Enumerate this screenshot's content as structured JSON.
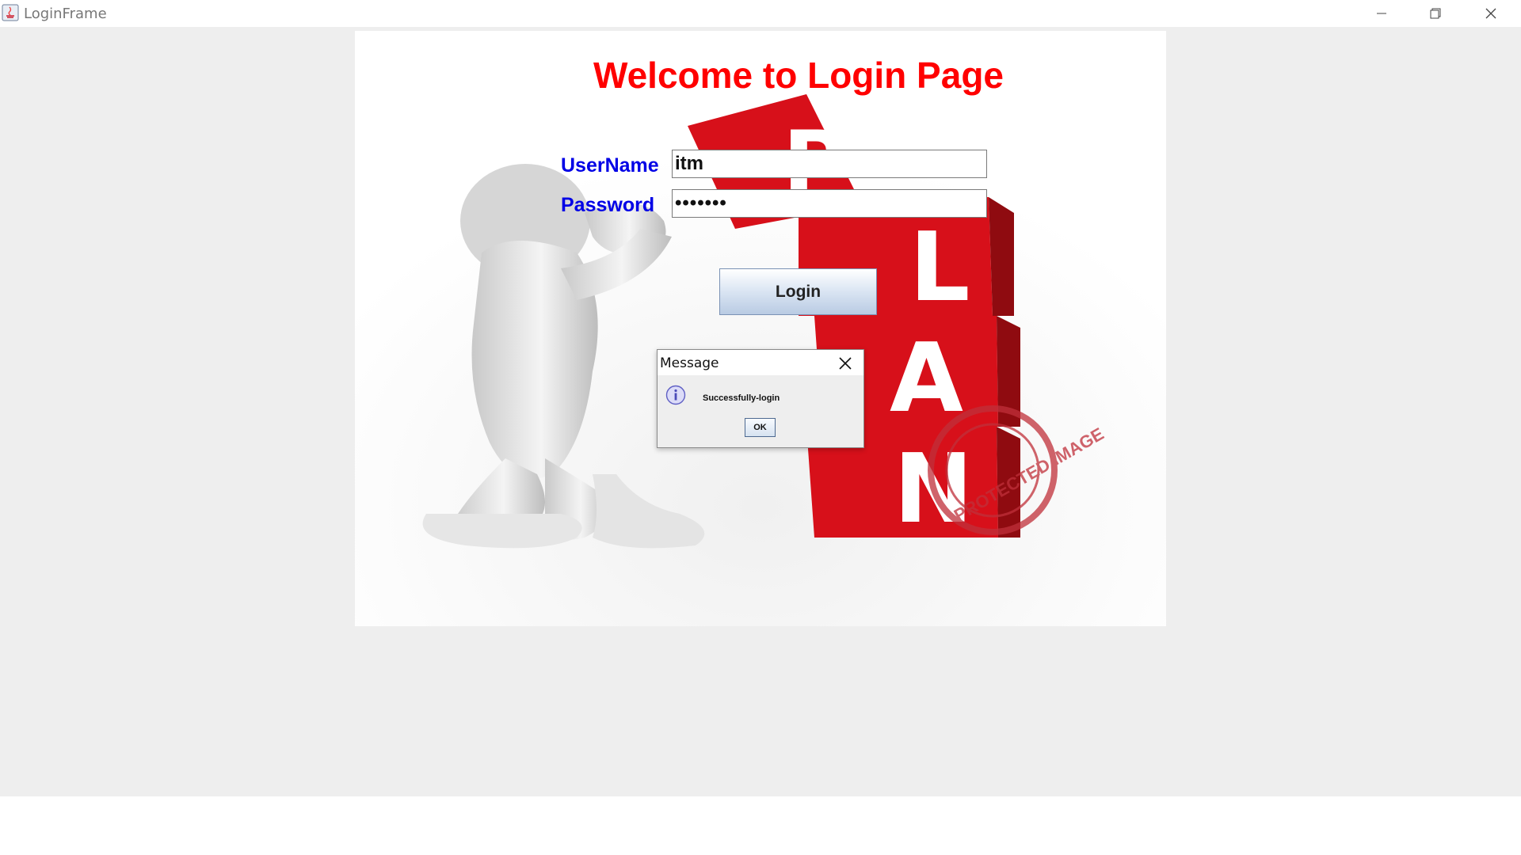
{
  "window": {
    "title": "LoginFrame"
  },
  "page": {
    "heading": "Welcome to Login Page"
  },
  "form": {
    "username_label": "UserName",
    "username_value": "itm",
    "password_label": "Password",
    "password_value": "•••••••",
    "login_label": "Login"
  },
  "dialog": {
    "title": "Message",
    "message": "Successfully-login",
    "ok_label": "OK"
  },
  "image": {
    "letters": [
      "P",
      "L",
      "A",
      "N"
    ],
    "watermark": "PROTECTED IMAGE"
  },
  "colors": {
    "heading": "#ff0000",
    "labels": "#0000e6",
    "cubes": "#d7101a"
  }
}
